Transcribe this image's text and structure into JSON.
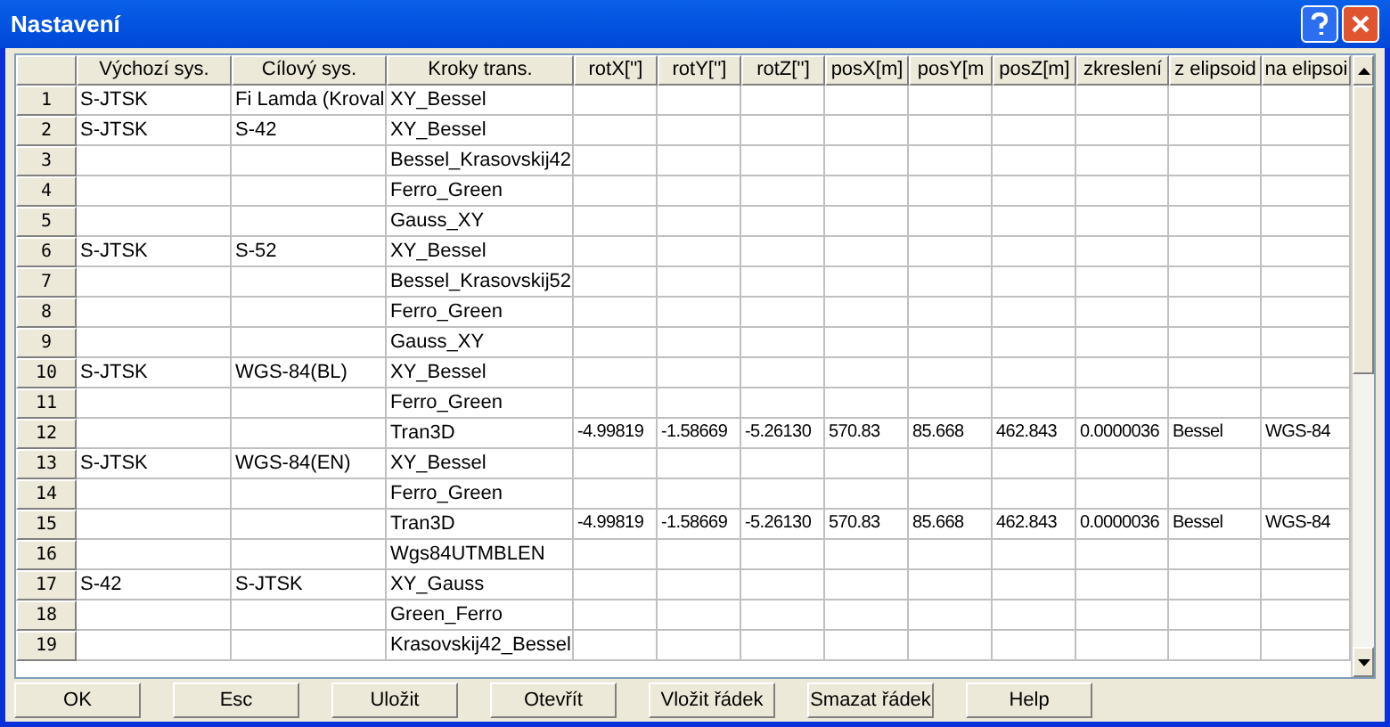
{
  "window": {
    "title": "Nastavení"
  },
  "table": {
    "columns": [
      "Výchozí sys.",
      "Cílový sys.",
      "Kroky trans.",
      "rotX['']",
      "rotY['']",
      "rotZ['']",
      "posX[m]",
      "posY[m",
      "posZ[m]",
      "zkreslení",
      "z elipsoid",
      "na elipsoi"
    ],
    "rows": [
      {
        "number": "1",
        "source": "S-JTSK",
        "target": "Fi Lamda (Kroval",
        "step": "XY_Bessel"
      },
      {
        "number": "2",
        "source": "S-JTSK",
        "target": "S-42",
        "step": "XY_Bessel"
      },
      {
        "number": "3",
        "step": "Bessel_Krasovskij42"
      },
      {
        "number": "4",
        "step": "Ferro_Green"
      },
      {
        "number": "5",
        "step": "Gauss_XY"
      },
      {
        "number": "6",
        "source": "S-JTSK",
        "target": "S-52",
        "step": "XY_Bessel"
      },
      {
        "number": "7",
        "step": "Bessel_Krasovskij52"
      },
      {
        "number": "8",
        "step": "Ferro_Green"
      },
      {
        "number": "9",
        "step": "Gauss_XY"
      },
      {
        "number": "10",
        "source": "S-JTSK",
        "target": "WGS-84(BL)",
        "step": "XY_Bessel"
      },
      {
        "number": "11",
        "step": "Ferro_Green"
      },
      {
        "number": "12",
        "step": "Tran3D",
        "params": [
          "-4.99819",
          "-1.58669",
          "-5.26130",
          "570.83",
          "85.668",
          "462.843",
          "0.0000036",
          "Bessel",
          "WGS-84"
        ]
      },
      {
        "number": "13",
        "source": "S-JTSK",
        "target": "WGS-84(EN)",
        "step": "XY_Bessel"
      },
      {
        "number": "14",
        "step": "Ferro_Green"
      },
      {
        "number": "15",
        "step": "Tran3D",
        "params": [
          "-4.99819",
          "-1.58669",
          "-5.26130",
          "570.83",
          "85.668",
          "462.843",
          "0.0000036",
          "Bessel",
          "WGS-84"
        ]
      },
      {
        "number": "16",
        "step": "Wgs84UTMBLEN"
      },
      {
        "number": "17",
        "source": "S-42",
        "target": "S-JTSK",
        "step": "XY_Gauss"
      },
      {
        "number": "18",
        "step": "Green_Ferro"
      },
      {
        "number": "19",
        "step": "Krasovskij42_Bessel"
      }
    ]
  },
  "buttons": [
    "OK",
    "Esc",
    "Uložit",
    "Otevřít",
    "Vložit řádek",
    "Smazat řádek",
    "Help"
  ]
}
